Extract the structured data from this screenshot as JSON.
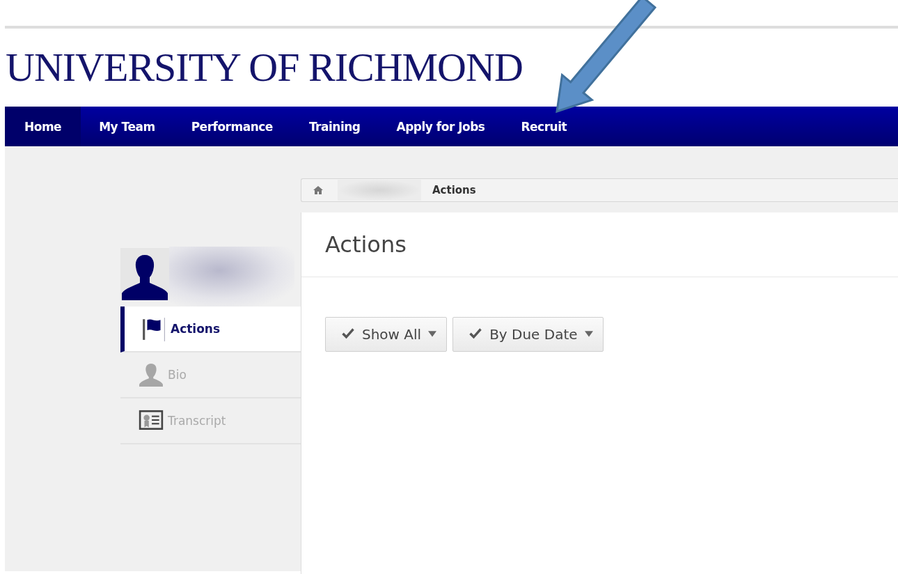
{
  "logo": "UNIVERSITY OF RICHMOND",
  "nav": [
    {
      "label": "Home",
      "selected": true
    },
    {
      "label": "My Team",
      "selected": false
    },
    {
      "label": "Performance",
      "selected": false
    },
    {
      "label": "Training",
      "selected": false
    },
    {
      "label": "Apply for Jobs",
      "selected": false
    },
    {
      "label": "Recruit",
      "selected": false
    }
  ],
  "breadcrumb": {
    "current": "Actions"
  },
  "sidebar": [
    {
      "label": "Actions",
      "kind": "flag",
      "selected": true
    },
    {
      "label": "Bio",
      "kind": "person",
      "selected": false
    },
    {
      "label": "Transcript",
      "kind": "certificate",
      "selected": false
    }
  ],
  "panel": {
    "title": "Actions",
    "filters": [
      {
        "label": "Show All"
      },
      {
        "label": "By Due Date"
      }
    ]
  }
}
